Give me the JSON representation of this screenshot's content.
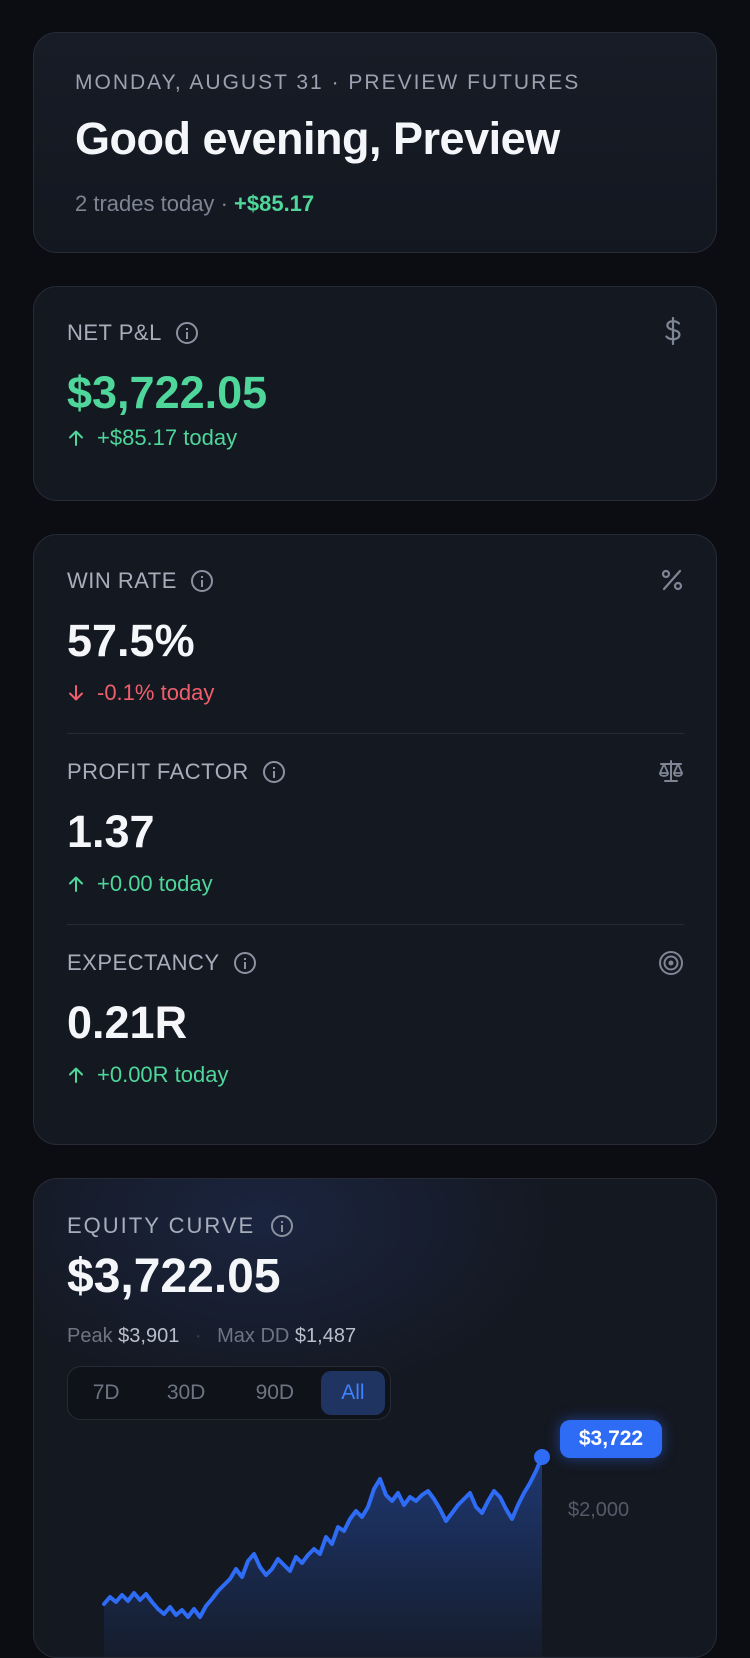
{
  "header": {
    "date_line": "MONDAY, AUGUST 31 · PREVIEW FUTURES",
    "greeting": "Good evening, Preview",
    "trades_today": "2 trades today",
    "separator": "·",
    "today_pnl": "+$85.17"
  },
  "net_pnl": {
    "label": "NET P&L",
    "icon": "dollar-icon",
    "value": "$3,722.05",
    "delta": "+$85.17 today",
    "direction": "up"
  },
  "metrics": [
    {
      "label": "WIN RATE",
      "icon": "percent-icon",
      "value": "57.5%",
      "delta": "-0.1% today",
      "direction": "down"
    },
    {
      "label": "PROFIT FACTOR",
      "icon": "scale-icon",
      "value": "1.37",
      "delta": "+0.00 today",
      "direction": "up"
    },
    {
      "label": "EXPECTANCY",
      "icon": "target-icon",
      "value": "0.21R",
      "delta": "+0.00R today",
      "direction": "up"
    }
  ],
  "equity": {
    "label": "EQUITY CURVE",
    "value": "$3,722.05",
    "peak_label": "Peak",
    "peak_value": "$3,901",
    "dd_label": "Max DD",
    "dd_value": "$1,487",
    "ranges": [
      "7D",
      "30D",
      "90D",
      "All"
    ],
    "active_range": "All",
    "current_tag": "$3,722",
    "y_tick": "$2,000"
  },
  "colors": {
    "positive": "#4fd69a",
    "negative": "#ef5f6b",
    "accent": "#2f6cf5",
    "card": "#141821",
    "background": "#0b0d12"
  }
}
